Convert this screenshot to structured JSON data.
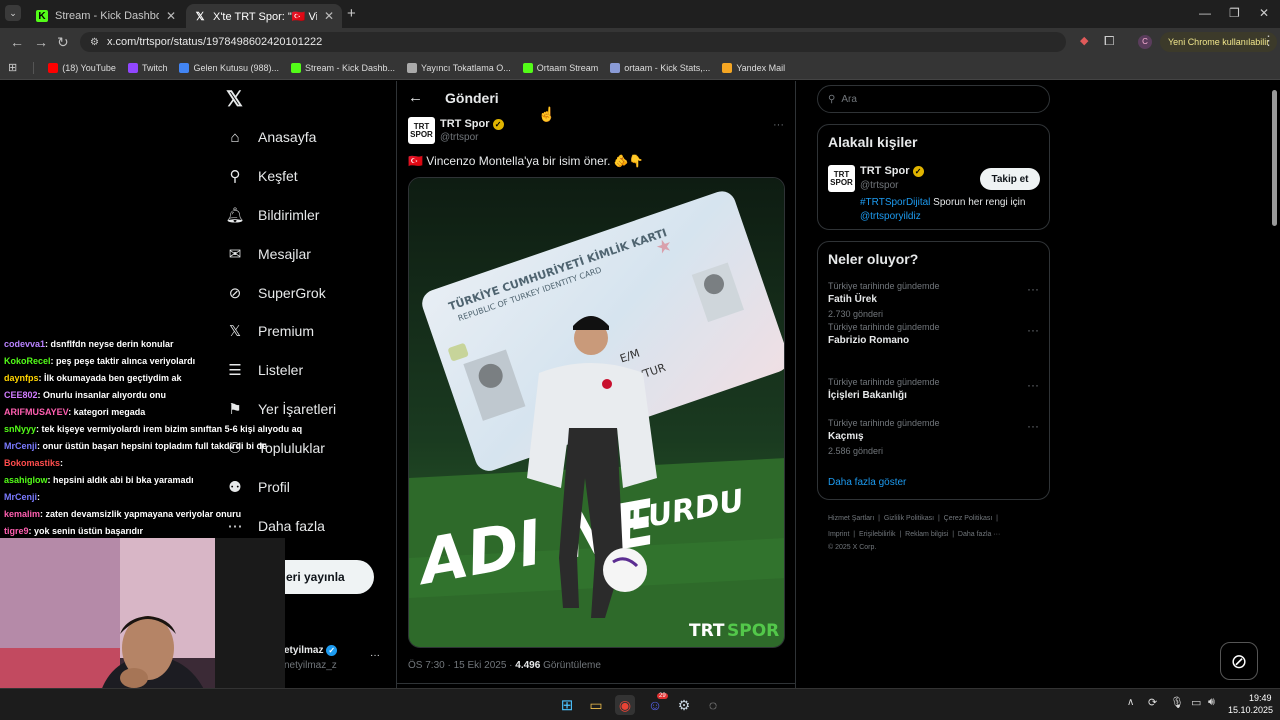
{
  "browser": {
    "tabs": [
      {
        "title": "Stream - Kick Dashboard",
        "close": "✕"
      },
      {
        "title": "X'te TRT Spor: \"🇹🇷 Vincenzo Mo",
        "close": "✕"
      }
    ],
    "new_tab": "+",
    "url": "x.com/trtspor/status/1978498602420101222",
    "chrome_update": "Yeni Chrome kullanılabilir",
    "profile_letter": "C",
    "bookmarks": [
      {
        "label": "(18) YouTube",
        "color": "#ff0000"
      },
      {
        "label": "Twitch",
        "color": "#9146ff"
      },
      {
        "label": "Gelen Kutusu (988)...",
        "color": "#4285f4"
      },
      {
        "label": "Stream - Kick Dashb...",
        "color": "#53fc18"
      },
      {
        "label": "Yayıncı Tokatlama O...",
        "color": "#aaaaaa"
      },
      {
        "label": "Ortaam Stream",
        "color": "#53fc18"
      },
      {
        "label": "ortaam - Kick Stats,...",
        "color": "#8a9bd6"
      },
      {
        "label": "Yandex Mail",
        "color": "#f5a623"
      }
    ]
  },
  "sidebar": {
    "logo": "𝕏",
    "items": [
      {
        "label": "Anasayfa",
        "icon": "⌂"
      },
      {
        "label": "Keşfet",
        "icon": "⚲"
      },
      {
        "label": "Bildirimler",
        "icon": "🔔︎"
      },
      {
        "label": "Mesajlar",
        "icon": "✉"
      },
      {
        "label": "SuperGrok",
        "icon": "⊘"
      },
      {
        "label": "Premium",
        "icon": "𝕏"
      },
      {
        "label": "Listeler",
        "icon": "☰"
      },
      {
        "label": "Yer İşaretleri",
        "icon": "⚑"
      },
      {
        "label": "Topluluklar",
        "icon": "⚇"
      },
      {
        "label": "Profil",
        "icon": "⚉"
      },
      {
        "label": "Daha fazla",
        "icon": "⋯"
      }
    ],
    "post_button": "eri yayınla",
    "account_name": "etyilmaz",
    "account_handle": "netyilmaz_z",
    "more": "···"
  },
  "main": {
    "header_title": "Gönderi",
    "back": "←",
    "post": {
      "author": "TRT Spor",
      "handle": "@trtspor",
      "text": "🇹🇷 Vincenzo Montella'ya bir isim öner. 🫵👇",
      "more": "···",
      "time": "ÖS 7:30 · 15 Eki 2025 · ",
      "views": "4.496",
      "views_label": " Görüntüleme",
      "image": {
        "card_title": "TÜRKİYE CUMHURİYETİ KİMLİK KARTI",
        "card_subtitle": "REPUBLIC OF TURKEY IDENTITY CARD",
        "sex": "E/M",
        "nationality": "TC/TUR",
        "headline_1": "ADI NE",
        "headline_2": "OLURDU",
        "brand_1": "TRT",
        "brand_2": "SPOR"
      }
    }
  },
  "right": {
    "search_placeholder": "Ara",
    "related_title": "Alakalı kişiler",
    "related": {
      "name": "TRT Spor",
      "handle": "@trtspor",
      "follow": "Takip et",
      "bio_hashtag": "#TRTSporDijital",
      "bio_text": " Sporun her rengi için",
      "bio_mention": "@trtsporyildiz"
    },
    "trends_title": "Neler oluyor?",
    "trends": [
      {
        "context": "Türkiye tarihinde gündemde",
        "name": "Fatih Ürek",
        "count": "2.730 gönderi"
      },
      {
        "context": "Türkiye tarihinde gündemde",
        "name": "Fabrizio Romano",
        "count": ""
      },
      {
        "context": "Türkiye tarihinde gündemde",
        "name": "İçişleri Bakanlığı",
        "count": ""
      },
      {
        "context": "Türkiye tarihinde gündemde",
        "name": "Kaçmış",
        "count": "2.586 gönderi"
      }
    ],
    "show_more": "Daha fazla göster",
    "footer_1": "Hizmet Şartları  |  Gizlilik Politikası  |  Çerez Politikası  |",
    "footer_2": "Imprint  |  Erişilebilirlik  |  Reklam bilgisi  |  Daha fazla ···",
    "footer_3": "© 2025 X Corp."
  },
  "chat": [
    {
      "user": "codevva1",
      "color": "#b983ff",
      "msg": ": dsnflfdn neyse derin konular"
    },
    {
      "user": "KokoRecel",
      "color": "#53fc18",
      "msg": ": peş peşe taktir alınca veriyolardı"
    },
    {
      "user": "daynfps",
      "color": "#ffd400",
      "msg": ": İlk okumayada ben geçtiydim ak"
    },
    {
      "user": "CEE802",
      "color": "#d17cff",
      "msg": ": Onurlu insanlar alıyordu onu"
    },
    {
      "user": "ARIFMUSAYEV",
      "color": "#ff5fb0",
      "msg": ": kategori megada"
    },
    {
      "user": "snNyyy",
      "color": "#53fc18",
      "msg": ": tek kişeye vermiyolardı irem bizim sınıftan 5-6 kişi alıyodu aq"
    },
    {
      "user": "MrCenji",
      "color": "#7a7aff",
      "msg": ": onur üstün başarı hepsini topladım full takdirdi bi de"
    },
    {
      "user": "Bokomastiks",
      "color": "#ff4d4d",
      "msg": ": "
    },
    {
      "user": "asahiglow",
      "color": "#53fc18",
      "msg": ": hepsini aldık abi bi bka yaramadı"
    },
    {
      "user": "MrCenji",
      "color": "#7a7aff",
      "msg": ": "
    },
    {
      "user": "kemalim",
      "color": "#ff5fb0",
      "msg": ": zaten devamsizlik yapmayana veriyolar onuru"
    },
    {
      "user": "tigre9",
      "color": "#ff5fb0",
      "msg": ": yok senin üstün başarıdır"
    }
  ],
  "taskbar": {
    "time": "19:49",
    "date": "15.10.2025",
    "discord_badge": "29"
  },
  "grok_icon": "⊘"
}
